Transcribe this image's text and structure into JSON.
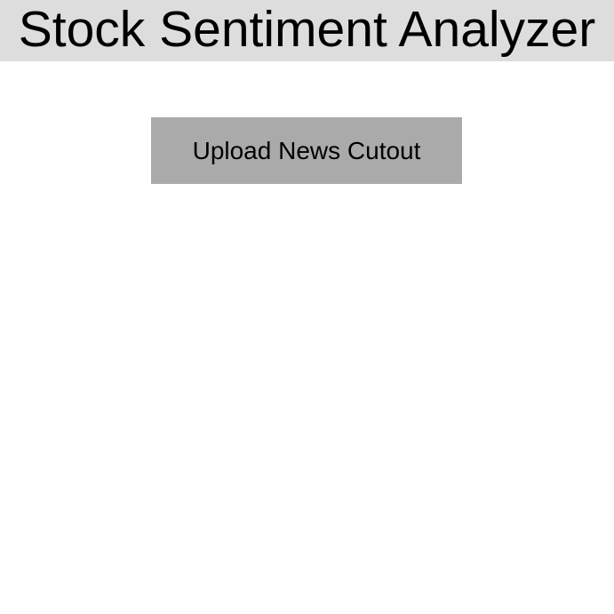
{
  "app": {
    "title": "Stock Sentiment Analyzer"
  },
  "main": {
    "upload_button_label": "Upload News Cutout"
  },
  "colors": {
    "header_background": "#dddddd",
    "button_background": "#aaaaaa",
    "page_background": "#ffffff",
    "text": "#000000"
  }
}
